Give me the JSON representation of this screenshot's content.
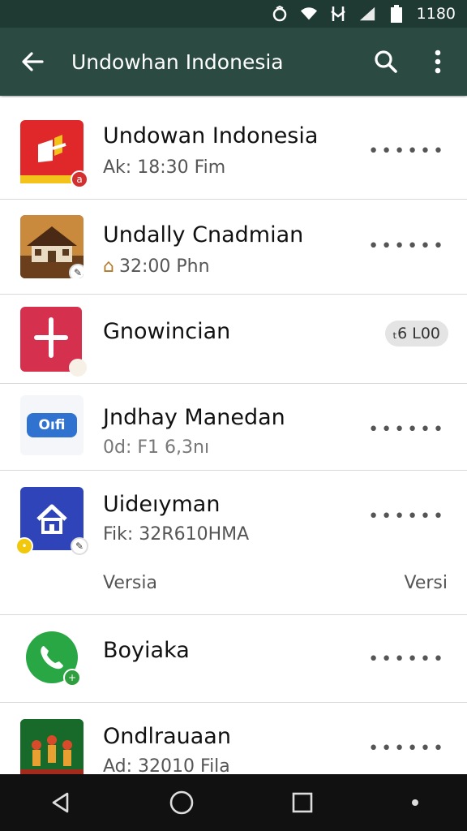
{
  "status_bar": {
    "time": "1180",
    "icons": [
      "alarm-icon",
      "wifi-icon",
      "data-icon",
      "signal-icon",
      "battery-icon"
    ]
  },
  "toolbar": {
    "title": "Undowhan Indonesia",
    "icons": [
      "back-arrow-icon",
      "search-icon",
      "more-vert-icon"
    ]
  },
  "apps": [
    {
      "name": "Undowan Indonesia",
      "subtitle": "Ak: 18:30 Fim",
      "action": "dots"
    },
    {
      "name": "Undally Cnadmian",
      "subtitle": "32:00 Phn",
      "action": "dots"
    },
    {
      "name": "Gnowincian",
      "subtitle": "",
      "action": "pill",
      "pill_label": "ₜ6 L00"
    },
    {
      "name": "Jndhay Manedan",
      "subtitle": "0d: F1 6,3nı",
      "action": "dots",
      "icon_text": "Oıfi"
    },
    {
      "name": "Uideıyman",
      "subtitle": "Fik: 32R610HMA",
      "action": "dots",
      "extra_left": "Versia",
      "extra_right": "Versi"
    },
    {
      "name": "Boyiaka",
      "subtitle": "",
      "action": "dots"
    },
    {
      "name": "Ondlrauaan",
      "subtitle": "Ad: 32010 Fila",
      "action": "dots"
    }
  ],
  "colors": {
    "status_bar": "#1f3a33",
    "toolbar": "#2b4a41",
    "navbar": "#111111"
  },
  "nav_bar": {
    "icons": [
      "back-triangle-icon",
      "home-circle-icon",
      "recents-square-icon",
      "dot-icon"
    ]
  }
}
